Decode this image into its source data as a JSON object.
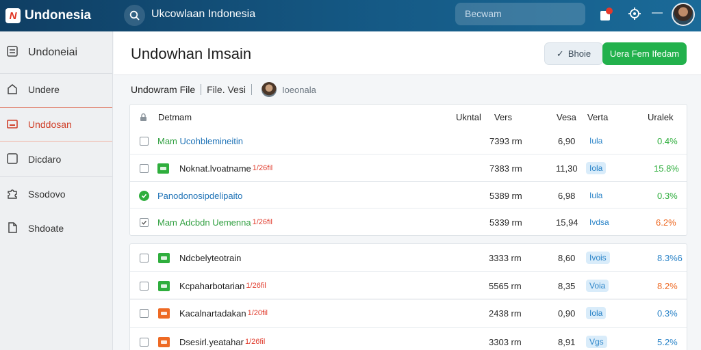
{
  "brand": {
    "logo_letter": "N",
    "name": "Undonesia"
  },
  "topbar": {
    "title": "Ukcowlaan Indonesia",
    "search_placeholder": "Becwam"
  },
  "sidebar": {
    "items": [
      {
        "label": "Undoneiai",
        "icon": "list-icon"
      },
      {
        "label": "Undere",
        "icon": "home-icon"
      },
      {
        "label": "Unddosan",
        "icon": "image-icon",
        "active": true
      },
      {
        "label": "Dicdaro",
        "icon": "square-icon"
      },
      {
        "label": "Ssodovo",
        "icon": "puzzle-icon"
      },
      {
        "label": "Shdoate",
        "icon": "document-icon"
      }
    ]
  },
  "header": {
    "title": "Undowhan Imsain",
    "share_label": "Bhoie",
    "primary_label": "Uera Fem Ifedam"
  },
  "breadcrumb": {
    "first": "Undowram File",
    "second": "File. Vesi",
    "third": "Ioeonala"
  },
  "table": {
    "columns": [
      "Detmam",
      "Ukntal",
      "Vers",
      "Vesa",
      "Verta",
      "Uralek"
    ],
    "rows": [
      {
        "prefix": "Mam",
        "name": "Ucohblemineitin",
        "tag": "",
        "size": "7393 rm",
        "val": "6,90",
        "pill": "Iula",
        "pct": "0.4%",
        "name_style": "green",
        "pill_bg": false,
        "pct_color": "green",
        "icon": "none"
      },
      {
        "prefix": "",
        "name": "Noknat.lvoatname",
        "tag": "1/26fil",
        "size": "7383 rm",
        "val": "11,30",
        "pill": "Iola",
        "pct": "15.8%",
        "name_style": "dark",
        "pill_bg": true,
        "pct_color": "green",
        "icon": "green-file"
      },
      {
        "prefix": "",
        "name": "Panodonosipdelipaito",
        "tag": "",
        "size": "5389 rm",
        "val": "6,98",
        "pill": "Iula",
        "pct": "0.3%",
        "name_style": "blue",
        "pill_bg": false,
        "pct_color": "green",
        "icon": "check-circle"
      },
      {
        "prefix": "Mam",
        "name": "Adcbdn Uemenna",
        "tag": "1/26fil",
        "size": "5339 rm",
        "val": "15,94",
        "pill": "Ivdsa",
        "pct": "6.2%",
        "name_style": "green",
        "pill_bg": false,
        "pct_color": "orange",
        "icon": "none",
        "checked": true
      },
      {
        "prefix": "",
        "name": "Ndcbelyteotrain",
        "tag": "",
        "size": "3333 rm",
        "val": "8,60",
        "pill": "Ivois",
        "pct": "8.3%6",
        "name_style": "dark",
        "pill_bg": true,
        "pct_color": "blue",
        "icon": "green-file"
      },
      {
        "prefix": "",
        "name": "Kcpaharbotarian",
        "tag": "1/26fil",
        "size": "5565 rm",
        "val": "8,35",
        "pill": "Voia",
        "pct": "8.2%",
        "name_style": "dark",
        "pill_bg": true,
        "pct_color": "orange",
        "icon": "green-file"
      },
      {
        "prefix": "",
        "name": "Kacalnartadakan",
        "tag": "1/20fil",
        "size": "2438 rm",
        "val": "0,90",
        "pill": "Iola",
        "pct": "0.3%",
        "name_style": "dark",
        "pill_bg": true,
        "pct_color": "blue",
        "icon": "orange-file"
      },
      {
        "prefix": "",
        "name": "Dsesirl.yeatahar",
        "tag": "1/26fil",
        "size": "3303 rm",
        "val": "8,91",
        "pill": "Vgs",
        "pct": "5.2%",
        "name_style": "dark",
        "pill_bg": true,
        "pct_color": "blue",
        "icon": "orange-file"
      }
    ]
  },
  "colors": {
    "topbar": "#155a86",
    "accent_green": "#22b14c",
    "active_red": "#d0402a",
    "link_blue": "#1f73b7",
    "orange": "#ee6a24"
  }
}
